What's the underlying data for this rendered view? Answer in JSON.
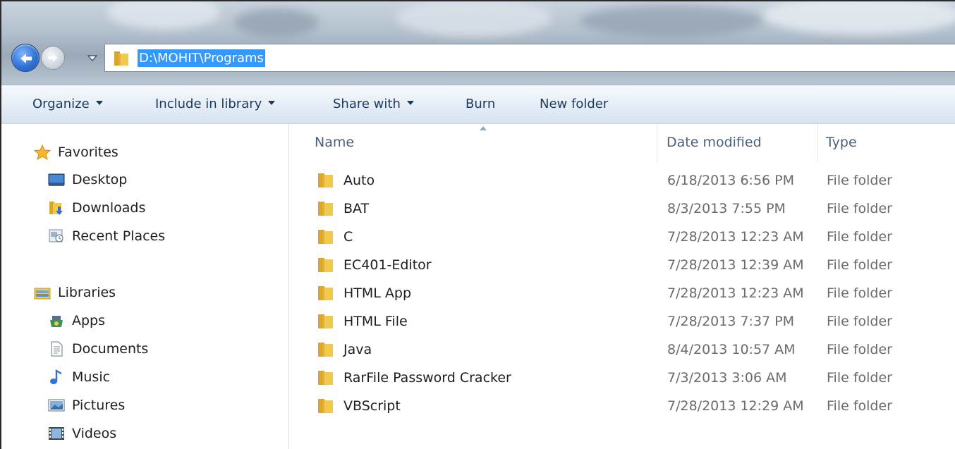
{
  "address_bar": {
    "path": "D:\\MOHIT\\Programs"
  },
  "command_bar": {
    "organize": "Organize",
    "include_in_library": "Include in library",
    "share_with": "Share with",
    "burn": "Burn",
    "new_folder": "New folder"
  },
  "nav_pane": {
    "favorites": {
      "label": "Favorites",
      "icon": "star-icon",
      "items": [
        {
          "label": "Desktop",
          "icon": "desktop-icon"
        },
        {
          "label": "Downloads",
          "icon": "downloads-icon"
        },
        {
          "label": "Recent Places",
          "icon": "recent-places-icon"
        }
      ]
    },
    "libraries": {
      "label": "Libraries",
      "icon": "libraries-icon",
      "items": [
        {
          "label": "Apps",
          "icon": "apps-icon"
        },
        {
          "label": "Documents",
          "icon": "documents-icon"
        },
        {
          "label": "Music",
          "icon": "music-icon"
        },
        {
          "label": "Pictures",
          "icon": "pictures-icon"
        },
        {
          "label": "Videos",
          "icon": "videos-icon"
        }
      ]
    }
  },
  "file_list": {
    "columns": {
      "name": "Name",
      "date_modified": "Date modified",
      "type": "Type"
    },
    "sorted_by": "Name",
    "rows": [
      {
        "name": "Auto",
        "date": "6/18/2013 6:56 PM",
        "type": "File folder"
      },
      {
        "name": "BAT",
        "date": "8/3/2013 7:55 PM",
        "type": "File folder"
      },
      {
        "name": "C",
        "date": "7/28/2013 12:23 AM",
        "type": "File folder"
      },
      {
        "name": "EC401-Editor",
        "date": "7/28/2013 12:39 AM",
        "type": "File folder"
      },
      {
        "name": "HTML App",
        "date": "7/28/2013 12:23 AM",
        "type": "File folder"
      },
      {
        "name": "HTML File",
        "date": "7/28/2013 7:37 PM",
        "type": "File folder"
      },
      {
        "name": "Java",
        "date": "8/4/2013 10:57 AM",
        "type": "File folder"
      },
      {
        "name": "RarFile Password Cracker",
        "date": "7/3/2013 3:06 AM",
        "type": "File folder"
      },
      {
        "name": "VBScript",
        "date": "7/28/2013 12:29 AM",
        "type": "File folder"
      }
    ]
  },
  "colors": {
    "selection": "#3399ff",
    "command_text": "#1e395b",
    "column_header_text": "#4c607a",
    "secondary_text": "#6b6b6b",
    "folder_yellow": "#f2c94c"
  }
}
